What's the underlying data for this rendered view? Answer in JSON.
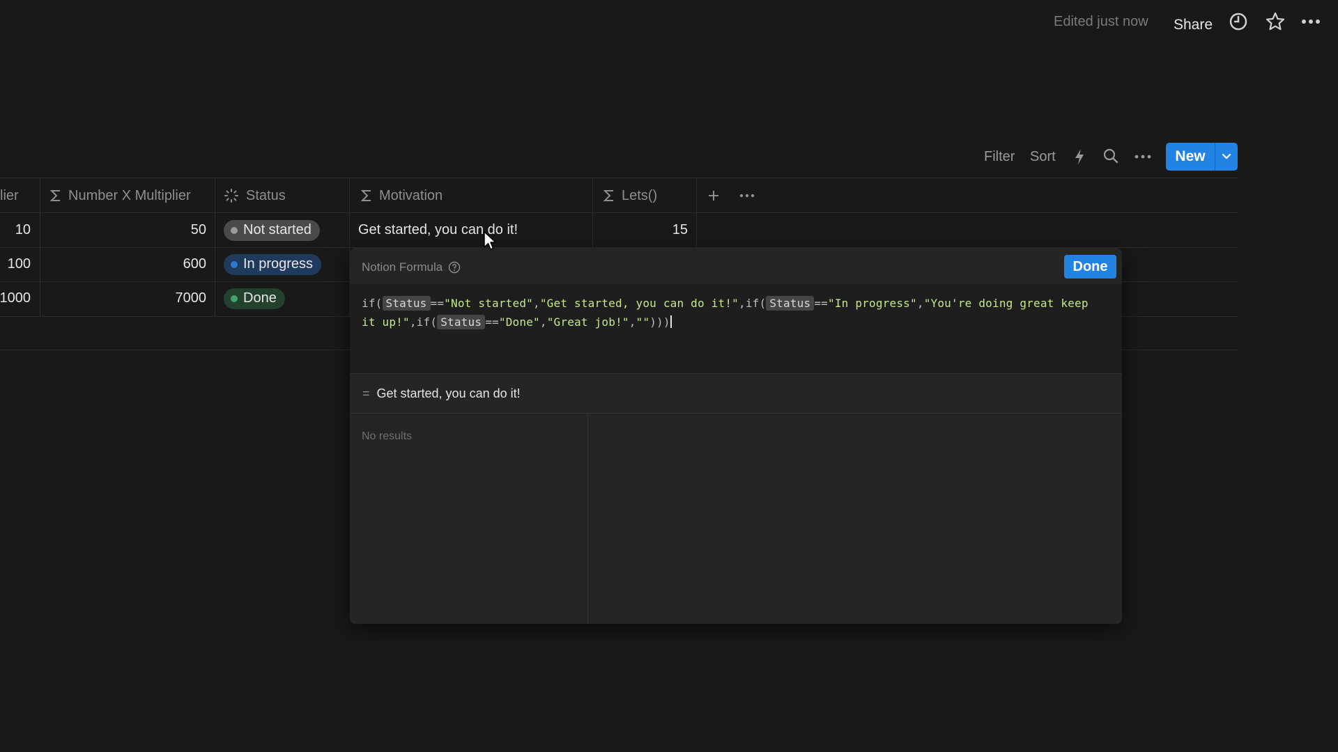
{
  "topbar": {
    "edited": "Edited just now",
    "share": "Share",
    "icons": [
      "clock-icon",
      "star-icon",
      "more-icon"
    ]
  },
  "toolbar": {
    "filter": "Filter",
    "sort": "Sort",
    "new": "New",
    "icons": [
      "lightning-icon",
      "search-icon",
      "more-icon",
      "chevron-down-icon"
    ]
  },
  "table": {
    "headers": {
      "multiplier": "lier",
      "number_x_multiplier": "Number X Multiplier",
      "status": "Status",
      "motivation": "Motivation",
      "lets": "Lets()"
    },
    "rows": [
      {
        "multiplier": "10",
        "number_x_multiplier": "50",
        "status": "Not started",
        "motivation": "Get started, you can do it!",
        "lets": "15"
      },
      {
        "multiplier": "100",
        "number_x_multiplier": "600",
        "status": "In progress",
        "motivation": "",
        "lets": ""
      },
      {
        "multiplier": "1000",
        "number_x_multiplier": "7000",
        "status": "Done",
        "motivation": "",
        "lets": ""
      }
    ],
    "status_colors": {
      "Not started": {
        "bg": "#4a4a4a",
        "dot": "#9b9b9b"
      },
      "In progress": {
        "bg": "#1f3a5c",
        "dot": "#2e7ad1"
      },
      "Done": {
        "bg": "#23412f",
        "dot": "#3fa46a"
      }
    }
  },
  "formula": {
    "title": "Notion Formula",
    "done": "Done",
    "code": {
      "p1": "if(",
      "t1": "Status",
      "p2": "==",
      "s1": "\"Not started\"",
      "p3": ",",
      "s2": "\"Get started, you can do it!\"",
      "p4": ",if(",
      "t2": "Status",
      "p5": "==",
      "s3": "\"In progress\"",
      "p6": ",",
      "s4": "\"You're doing great keep it up!\"",
      "p7": ",if(",
      "t3": "Status",
      "p8": "==",
      "s5": "\"Done\"",
      "p9": ",",
      "s6": "\"Great job!\"",
      "p10": ",",
      "s7": "\"\"",
      "p11": ")))"
    },
    "result_prefix": "=",
    "result": "Get started, you can do it!",
    "no_results": "No results"
  },
  "colors": {
    "accent": "#2383e2",
    "background": "#191919",
    "panel": "#252525"
  }
}
